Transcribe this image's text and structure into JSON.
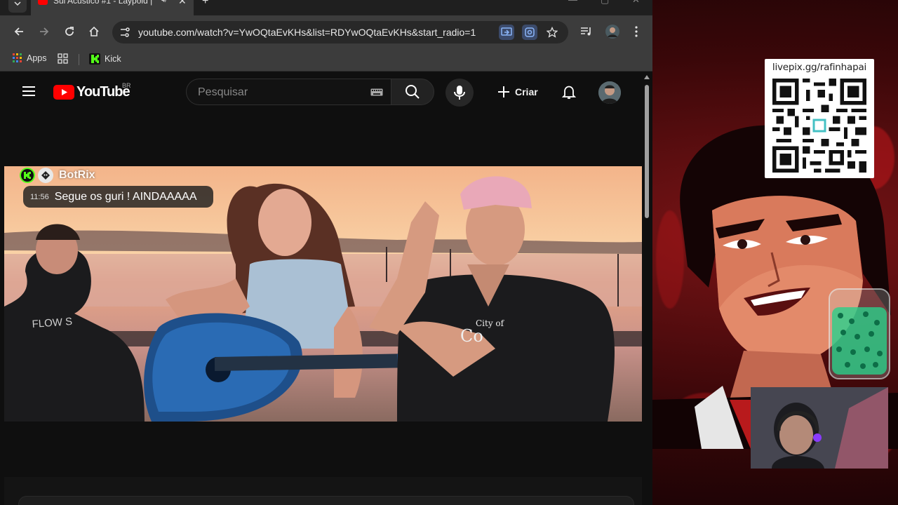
{
  "browser": {
    "tab_title": "Sul Acústico #1 - Laypold |",
    "url": "youtube.com/watch?v=YwOQtaEvKHs&list=RDYwOQtaEvKHs&start_radio=1",
    "bookmarks": [
      {
        "label": "Apps",
        "icon": "apps-grid-icon"
      },
      {
        "label": "",
        "icon": "grid-icon"
      },
      {
        "label": "Kick",
        "icon": "kick-logo-icon"
      }
    ]
  },
  "youtube": {
    "logo_text": "YouTube",
    "country_code": "BR",
    "search_placeholder": "Pesquisar",
    "create_label": "Criar"
  },
  "chat": {
    "username": "BotRix",
    "time": "11:56",
    "message": "Segue os guri ! AINDAAAAA"
  },
  "stream": {
    "qr_url": "livepix.gg/rafinhapai"
  },
  "colors": {
    "youtube_red": "#ff0000",
    "kick_green": "#53fc18",
    "stream_red": "#c0171b"
  }
}
